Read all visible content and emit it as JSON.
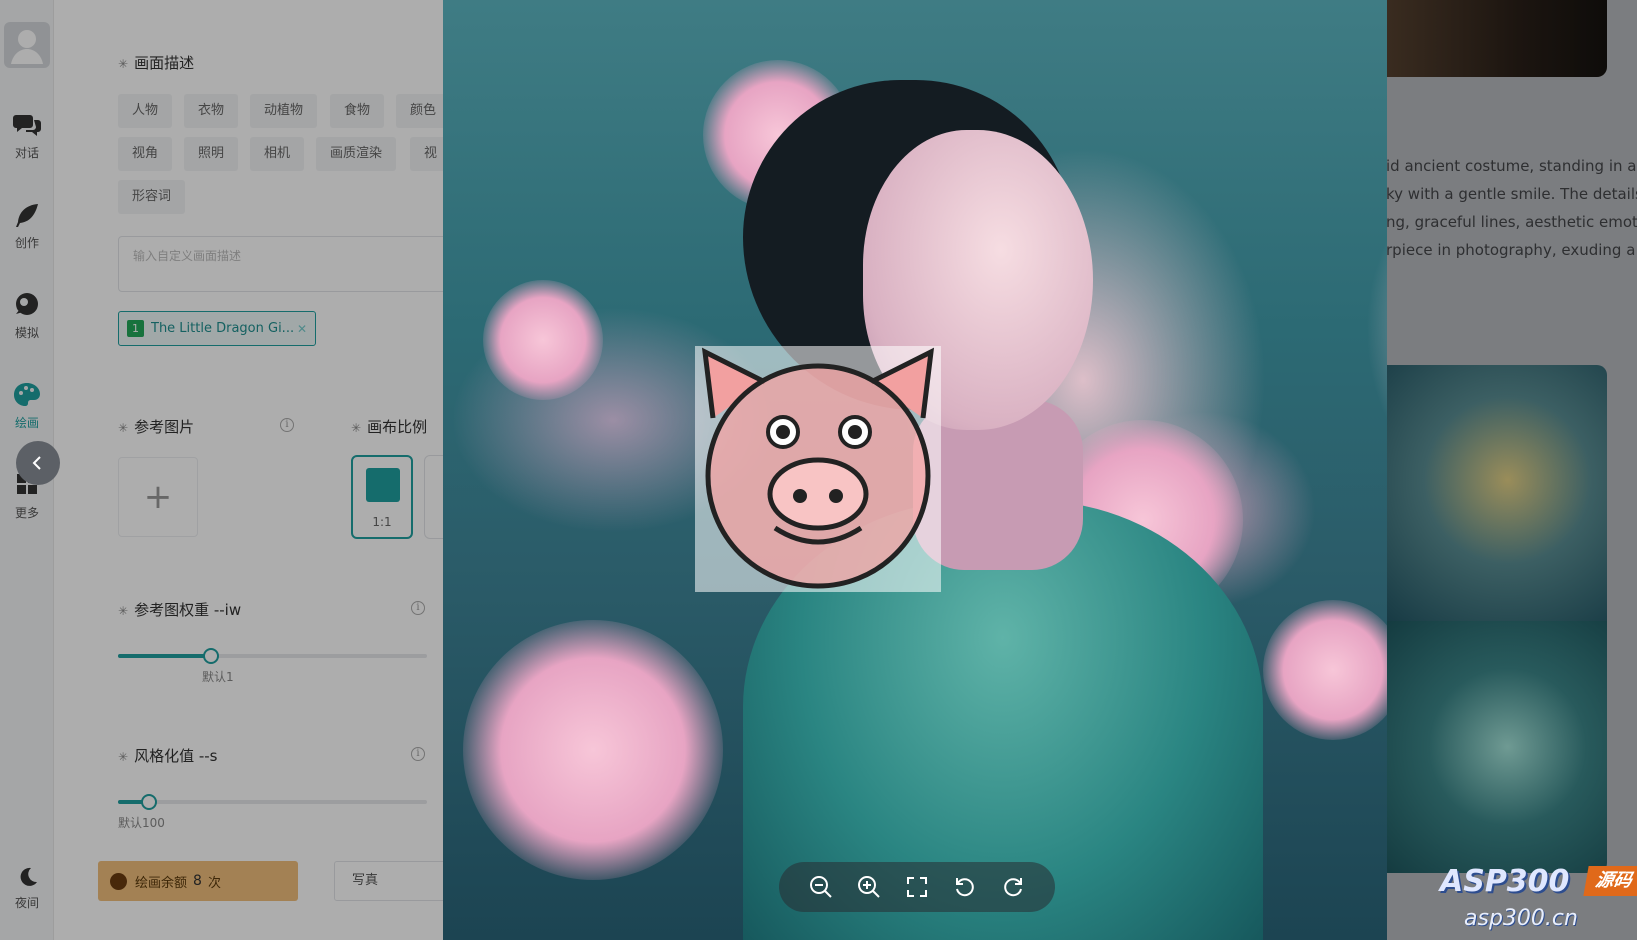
{
  "sidebar": {
    "items": [
      {
        "label": "对话",
        "icon": "chat-icon"
      },
      {
        "label": "创作",
        "icon": "feather-icon"
      },
      {
        "label": "模拟",
        "icon": "user-bubble-icon"
      },
      {
        "label": "绘画",
        "icon": "palette-icon"
      },
      {
        "label": "更多",
        "icon": "grid-icon"
      }
    ],
    "night_label": "夜间",
    "night_icon": "moon-icon"
  },
  "panel": {
    "scene_title": "画面描述",
    "chips_row1": [
      "人物",
      "衣物",
      "动植物",
      "食物",
      "颜色"
    ],
    "chips_row2": [
      "视角",
      "照明",
      "相机",
      "画质渲染",
      "视"
    ],
    "chips_row3": [
      "形容词"
    ],
    "custom_placeholder": "输入自定义画面描述",
    "tag_number": "1",
    "tag_text": "The Little Dragon Gi...",
    "ref_title": "参考图片",
    "ratio_title": "画布比例",
    "ratio_label": "1:1",
    "iw_title": "参考图权重 --iw",
    "iw_hint": "默认1",
    "iw_value": 0.3,
    "s_title": "风格化值 --s",
    "s_hint": "默认100",
    "s_value": 0.1,
    "quota_label": "绘画余额",
    "quota_count": "8",
    "quota_unit": "次",
    "mode_label": "写真"
  },
  "gallery": {
    "description_lines": [
      "id ancient costume, standing in a d",
      "ky with a gentle smile. The details a",
      "ng, graceful lines, aesthetic emotio",
      "rpiece in photography, exuding a s"
    ]
  },
  "watermark": {
    "brand": "ASP300",
    "tag": "源码",
    "site": "asp300.cn"
  },
  "preview_toolbar": [
    "zoom-out-icon",
    "zoom-in-icon",
    "fullscreen-icon",
    "rotate-left-icon",
    "rotate-right-icon"
  ],
  "colors": {
    "accent": "#1f9f9f",
    "quota_bg": "#f1bf7d"
  }
}
